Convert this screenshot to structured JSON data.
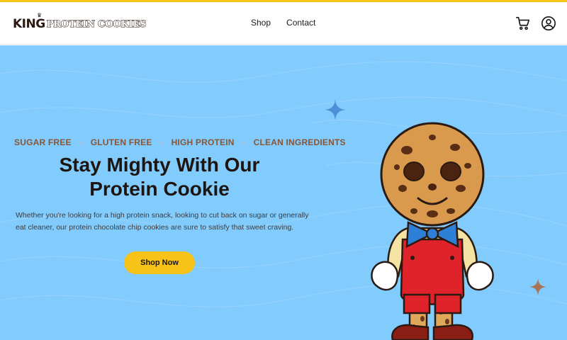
{
  "brand": {
    "name_part1": "KING",
    "name_part2": "PROTEIN COOKIES"
  },
  "nav": {
    "items": [
      {
        "label": "Shop"
      },
      {
        "label": "Contact"
      }
    ]
  },
  "header": {
    "icons": [
      "cart-icon",
      "account-icon"
    ]
  },
  "hero": {
    "features": [
      "SUGAR FREE",
      "GLUTEN FREE",
      "HIGH PROTEIN",
      "CLEAN INGREDIENTS"
    ],
    "headline_line1": "Stay Mighty With Our",
    "headline_line2": "Protein Cookie",
    "description": "Whether you're looking for a high protein snack, looking to cut back on sugar or generally eat cleaner, our protein chocolate chip cookies are sure to satisfy that sweet craving.",
    "cta_label": "Shop Now"
  },
  "colors": {
    "accent_yellow": "#f7c318",
    "hero_background": "#82cbfd",
    "feature_text": "#8a5535",
    "headline_text": "#1e1410"
  }
}
